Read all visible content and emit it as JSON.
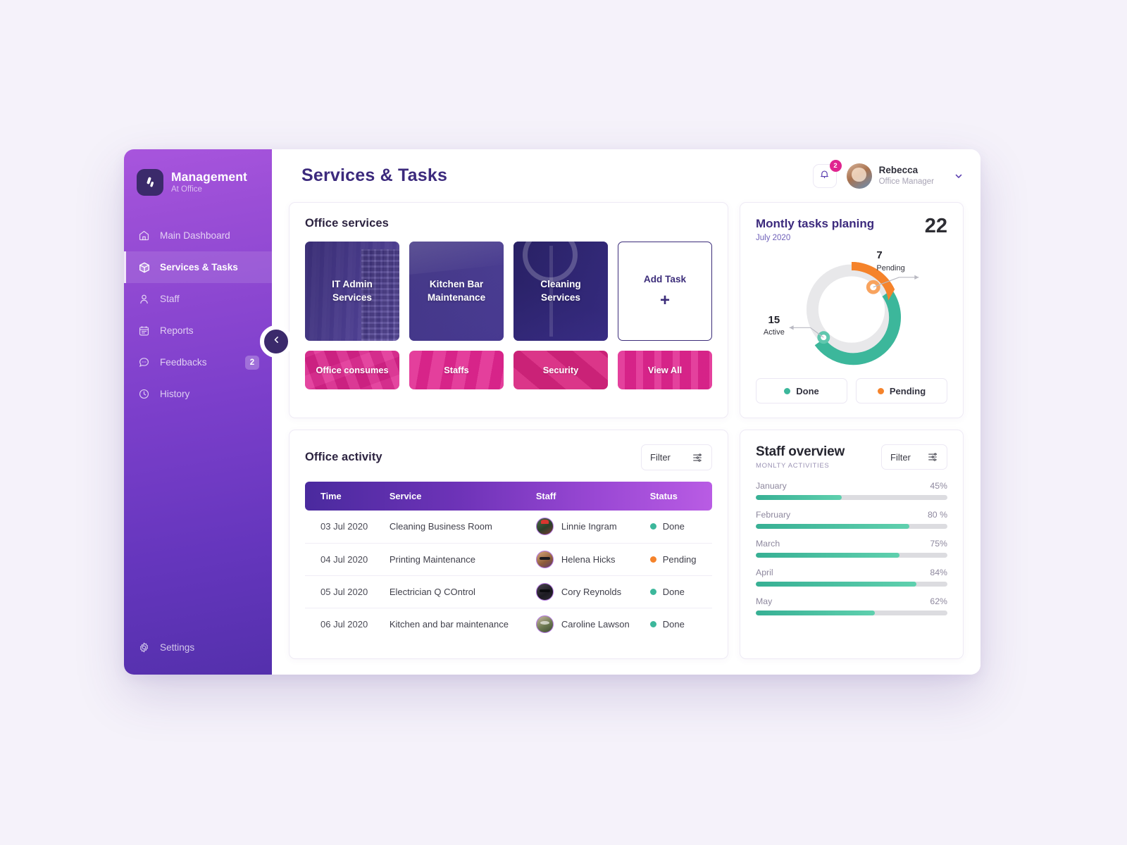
{
  "brand": {
    "title": "Management",
    "subtitle": "At Office",
    "logo_icon": "slash-logo-icon"
  },
  "sidebar": {
    "items": [
      {
        "label": "Main Dashboard",
        "icon": "home-icon",
        "active": false,
        "badge": ""
      },
      {
        "label": "Services & Tasks",
        "icon": "box-icon",
        "active": true,
        "badge": ""
      },
      {
        "label": "Staff",
        "icon": "user-icon",
        "active": false,
        "badge": ""
      },
      {
        "label": "Reports",
        "icon": "calendar-icon",
        "active": false,
        "badge": ""
      },
      {
        "label": "Feedbacks",
        "icon": "chat-icon",
        "active": false,
        "badge": "2"
      },
      {
        "label": "History",
        "icon": "clock-icon",
        "active": false,
        "badge": ""
      }
    ],
    "settings": {
      "label": "Settings",
      "icon": "gear-icon"
    },
    "collapse_icon": "chevron-left-icon"
  },
  "header": {
    "page_title": "Services & Tasks",
    "notifications": {
      "icon": "bell-icon",
      "count": "2"
    },
    "user": {
      "name": "Rebecca",
      "role": "Office Manager",
      "avatar": "user-avatar",
      "chevron": "chevron-down-icon"
    }
  },
  "office_services": {
    "title": "Office services",
    "tiles": [
      {
        "label": "IT Admin\nServices",
        "style": "photo-it"
      },
      {
        "label": "Kitchen Bar\nMaintenance",
        "style": "photo-kb"
      },
      {
        "label": "Cleaning\nServices",
        "style": "photo-cl"
      }
    ],
    "add_tile": {
      "label": "Add Task",
      "plus": "+"
    },
    "quick_tiles": [
      {
        "label": "Office consumes"
      },
      {
        "label": "Staffs"
      },
      {
        "label": "Security"
      },
      {
        "label": "View All"
      }
    ]
  },
  "monthly_tasks": {
    "title": "Montly tasks planing",
    "period": "July 2020",
    "total": "22",
    "legend": [
      {
        "label": "Done",
        "color": "#3cb79b"
      },
      {
        "label": "Pending",
        "color": "#f5832b"
      }
    ],
    "callouts": [
      {
        "value": "7",
        "label": "Pending"
      },
      {
        "value": "15",
        "label": "Active"
      }
    ]
  },
  "office_activity": {
    "title": "Office activity",
    "filter": {
      "label": "Filter",
      "icon": "sliders-icon"
    },
    "columns": [
      "Time",
      "Service",
      "Staff",
      "Status"
    ],
    "rows": [
      {
        "time": "03 Jul 2020",
        "service": "Cleaning Business Room",
        "staff": "Linnie Ingram",
        "status": "Done",
        "status_color": "#3cb79b"
      },
      {
        "time": "04 Jul 2020",
        "service": "Printing Maintenance",
        "staff": "Helena Hicks",
        "status": "Pending",
        "status_color": "#f5832b"
      },
      {
        "time": "05 Jul 2020",
        "service": "Electrician Q COntrol",
        "staff": "Cory Reynolds",
        "status": "Done",
        "status_color": "#3cb79b"
      },
      {
        "time": "06 Jul 2020",
        "service": "Kitchen and bar maintenance",
        "staff": "Caroline Lawson",
        "status": "Done",
        "status_color": "#3cb79b"
      }
    ]
  },
  "staff_overview": {
    "title": "Staff overview",
    "subtitle": "MONLTY ACTIVITIES",
    "filter": {
      "label": "Filter",
      "icon": "sliders-icon"
    },
    "rows": [
      {
        "month": "January",
        "pct_label": "45%",
        "pct": 45
      },
      {
        "month": "February",
        "pct_label": "80 %",
        "pct": 80
      },
      {
        "month": "March",
        "pct_label": "75%",
        "pct": 75
      },
      {
        "month": "April",
        "pct_label": "84%",
        "pct": 84
      },
      {
        "month": "May",
        "pct_label": "62%",
        "pct": 62
      }
    ]
  },
  "chart_data": {
    "type": "pie",
    "title": "Montly tasks planing",
    "subtitle": "July 2020",
    "total": 22,
    "categories": [
      "Pending",
      "Active"
    ],
    "values": [
      7,
      15
    ],
    "colors": [
      "#f5832b",
      "#3cb79b"
    ],
    "track_color": "#e8e8ea",
    "legend": [
      "Done",
      "Pending"
    ],
    "legend_position": "bottom",
    "annotations": [
      {
        "text": "7 Pending",
        "value": 7
      },
      {
        "text": "15 Active",
        "value": 15
      }
    ]
  }
}
